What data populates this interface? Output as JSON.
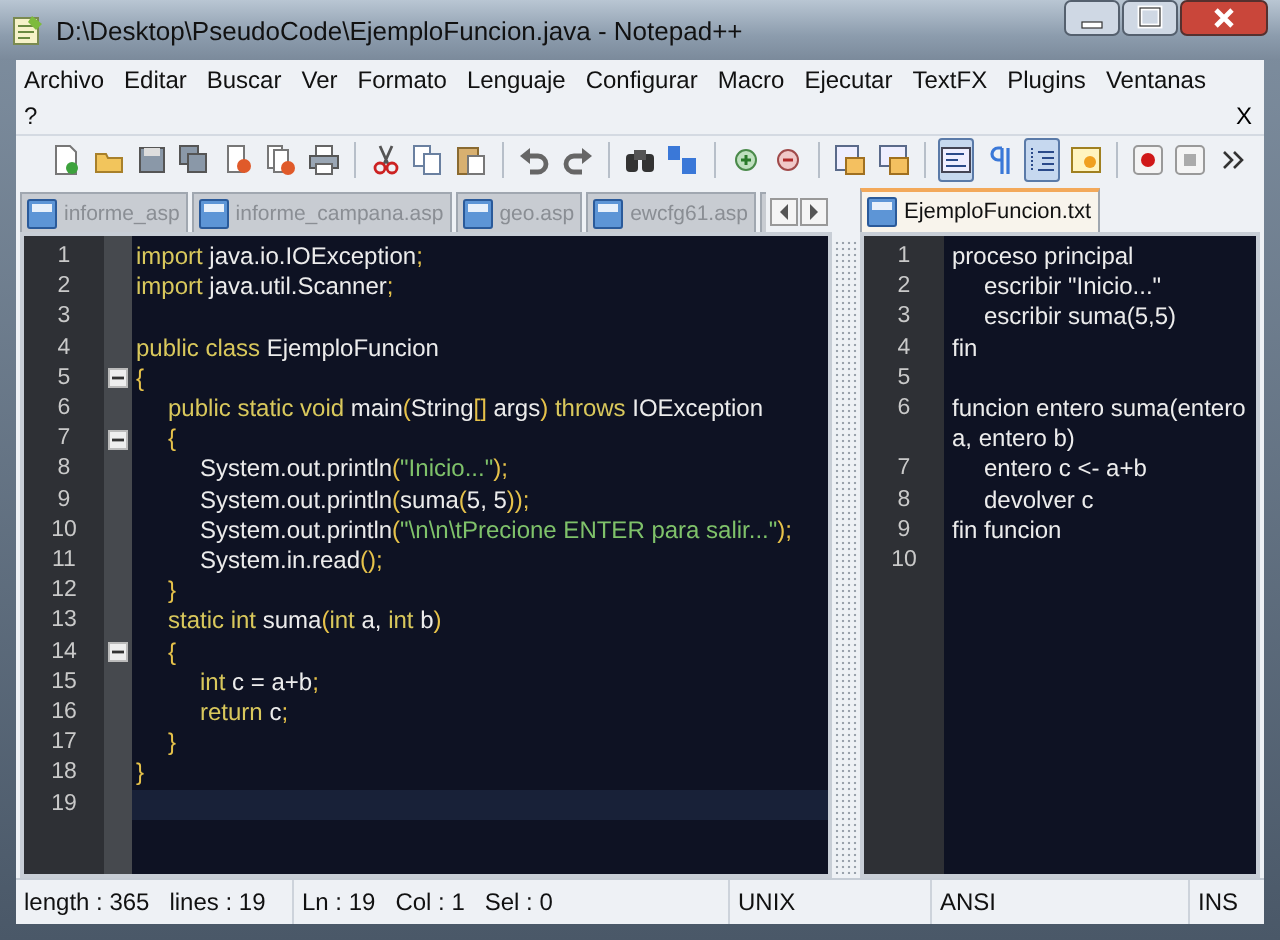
{
  "window": {
    "title": "D:\\Desktop\\PseudoCode\\EjemploFuncion.java - Notepad++"
  },
  "menu": {
    "items": [
      "Archivo",
      "Editar",
      "Buscar",
      "Ver",
      "Formato",
      "Lenguaje",
      "Configurar",
      "Macro",
      "Ejecutar",
      "TextFX",
      "Plugins",
      "Ventanas",
      "?"
    ],
    "close_document": "X"
  },
  "toolbar": [
    {
      "kind": "new",
      "pressed": false
    },
    {
      "kind": "open",
      "pressed": false
    },
    {
      "kind": "save",
      "pressed": false
    },
    {
      "kind": "save-all",
      "pressed": false
    },
    {
      "kind": "close",
      "pressed": false
    },
    {
      "kind": "close-all",
      "pressed": false
    },
    {
      "kind": "print",
      "pressed": false
    },
    {
      "kind": "separator"
    },
    {
      "kind": "cut",
      "pressed": false
    },
    {
      "kind": "copy",
      "pressed": false
    },
    {
      "kind": "paste",
      "pressed": false
    },
    {
      "kind": "separator"
    },
    {
      "kind": "undo",
      "pressed": false
    },
    {
      "kind": "redo",
      "pressed": false
    },
    {
      "kind": "separator"
    },
    {
      "kind": "find",
      "pressed": false
    },
    {
      "kind": "replace",
      "pressed": false
    },
    {
      "kind": "separator"
    },
    {
      "kind": "zoom-in",
      "pressed": false
    },
    {
      "kind": "zoom-out",
      "pressed": false
    },
    {
      "kind": "separator"
    },
    {
      "kind": "sync-vertical",
      "pressed": false
    },
    {
      "kind": "sync-horizontal",
      "pressed": false
    },
    {
      "kind": "separator"
    },
    {
      "kind": "word-wrap",
      "pressed": true
    },
    {
      "kind": "all-chars",
      "pressed": false
    },
    {
      "kind": "indent-guide",
      "pressed": true
    },
    {
      "kind": "user-language",
      "pressed": false
    },
    {
      "kind": "separator"
    },
    {
      "kind": "record",
      "pressed": false
    },
    {
      "kind": "stop",
      "pressed": false
    },
    {
      "kind": "more",
      "pressed": false
    }
  ],
  "left_view": {
    "tabs": [
      {
        "label": "informe_asp",
        "selected": false
      },
      {
        "label": "informe_campana.asp",
        "selected": false
      },
      {
        "label": "geo.asp",
        "selected": false
      },
      {
        "label": "ewcfg61.asp",
        "selected": false
      },
      {
        "selected": false
      }
    ],
    "lines": [
      {
        "number": "1",
        "fold": false,
        "current": false,
        "tokens": [
          {
            "kind": "keyword",
            "text": "import"
          },
          {
            "kind": "plain",
            "text": " java.io.IOException"
          },
          {
            "kind": "punct",
            "text": ";"
          }
        ]
      },
      {
        "number": "2",
        "fold": false,
        "current": false,
        "tokens": [
          {
            "kind": "keyword",
            "text": "import"
          },
          {
            "kind": "plain",
            "text": " java.util.Scanner"
          },
          {
            "kind": "punct",
            "text": ";"
          }
        ]
      },
      {
        "number": "3",
        "fold": false,
        "current": false
      },
      {
        "number": "4",
        "fold": false,
        "current": false,
        "tokens": [
          {
            "kind": "keyword",
            "text": "public class"
          },
          {
            "kind": "plain",
            "text": " EjemploFuncion"
          }
        ]
      },
      {
        "number": "5",
        "fold": true,
        "current": false,
        "tokens": [
          {
            "kind": "punct",
            "text": "{"
          }
        ]
      },
      {
        "number": "6",
        "fold": false,
        "current": false,
        "tokens": [
          {
            "kind": "keyword",
            "text": "\tpublic static void"
          },
          {
            "kind": "plain",
            "text": " main"
          },
          {
            "kind": "punct",
            "text": "("
          },
          {
            "kind": "plain",
            "text": "String"
          },
          {
            "kind": "punct",
            "text": "[]"
          },
          {
            "kind": "plain",
            "text": " args"
          },
          {
            "kind": "punct",
            "text": ")"
          },
          {
            "kind": "keyword",
            "text": " throws"
          },
          {
            "kind": "plain",
            "text": " IOException"
          }
        ]
      },
      {
        "number": "7",
        "fold": true,
        "current": false,
        "tokens": [
          {
            "kind": "punct",
            "text": "\t{"
          }
        ]
      },
      {
        "number": "8",
        "fold": false,
        "current": false,
        "tokens": [
          {
            "kind": "plain",
            "text": "\t\tSystem.out.println"
          },
          {
            "kind": "punct",
            "text": "("
          },
          {
            "kind": "string",
            "text": "\"Inicio...\""
          },
          {
            "kind": "punct",
            "text": ");"
          }
        ]
      },
      {
        "number": "9",
        "fold": false,
        "current": false,
        "tokens": [
          {
            "kind": "plain",
            "text": "\t\tSystem.out.println"
          },
          {
            "kind": "punct",
            "text": "("
          },
          {
            "kind": "plain",
            "text": "suma"
          },
          {
            "kind": "punct",
            "text": "("
          },
          {
            "kind": "plain",
            "text": "5, 5"
          },
          {
            "kind": "punct",
            "text": "));"
          }
        ]
      },
      {
        "number": "10",
        "fold": false,
        "current": false,
        "tokens": [
          {
            "kind": "plain",
            "text": "\t\tSystem.out.println"
          },
          {
            "kind": "punct",
            "text": "("
          },
          {
            "kind": "string",
            "text": "\"\\n\\n\\tPrecione ENTER para salir...\""
          },
          {
            "kind": "punct",
            "text": ");"
          }
        ]
      },
      {
        "number": "11",
        "fold": false,
        "current": false,
        "tokens": [
          {
            "kind": "plain",
            "text": "\t\tSystem.in.read"
          },
          {
            "kind": "punct",
            "text": "();"
          }
        ]
      },
      {
        "number": "12",
        "fold": false,
        "current": false,
        "tokens": [
          {
            "kind": "punct",
            "text": "\t}"
          }
        ]
      },
      {
        "number": "13",
        "fold": false,
        "current": false,
        "tokens": [
          {
            "kind": "keyword",
            "text": "\tstatic int"
          },
          {
            "kind": "plain",
            "text": " suma"
          },
          {
            "kind": "punct",
            "text": "("
          },
          {
            "kind": "keyword",
            "text": "int"
          },
          {
            "kind": "plain",
            "text": " a, "
          },
          {
            "kind": "keyword",
            "text": "int"
          },
          {
            "kind": "plain",
            "text": " b"
          },
          {
            "kind": "punct",
            "text": ")"
          }
        ]
      },
      {
        "number": "14",
        "fold": true,
        "current": false,
        "tokens": [
          {
            "kind": "punct",
            "text": "\t{"
          }
        ]
      },
      {
        "number": "15",
        "fold": false,
        "current": false,
        "tokens": [
          {
            "kind": "keyword",
            "text": "\t\tint"
          },
          {
            "kind": "plain",
            "text": " c = a+b"
          },
          {
            "kind": "punct",
            "text": ";"
          }
        ]
      },
      {
        "number": "16",
        "fold": false,
        "current": false,
        "tokens": [
          {
            "kind": "keyword",
            "text": "\t\treturn"
          },
          {
            "kind": "plain",
            "text": " c"
          },
          {
            "kind": "punct",
            "text": ";"
          }
        ]
      },
      {
        "number": "17",
        "fold": false,
        "current": false,
        "tokens": [
          {
            "kind": "punct",
            "text": "\t}"
          }
        ]
      },
      {
        "number": "18",
        "fold": false,
        "current": false,
        "tokens": [
          {
            "kind": "punct",
            "text": "}"
          }
        ]
      },
      {
        "number": "19",
        "fold": false,
        "current": true
      }
    ]
  },
  "right_view": {
    "tabs": [
      {
        "label": "EjemploFuncion.txt",
        "selected": true
      }
    ],
    "lines": [
      {
        "number": "1",
        "text": "proceso principal"
      },
      {
        "number": "2",
        "text": "\tescribir \"Inicio...\""
      },
      {
        "number": "3",
        "text": "\tescribir suma(5,5)"
      },
      {
        "number": "4",
        "text": "fin"
      },
      {
        "number": "5"
      },
      {
        "number": "6",
        "text": "funcion entero suma(entero a, entero b)"
      },
      {
        "number": "7",
        "text": "\tentero c <- a+b"
      },
      {
        "number": "8",
        "text": "\tdevolver c"
      },
      {
        "number": "9",
        "text": "fin funcion"
      },
      {
        "number": "10"
      }
    ]
  },
  "status_bar": [
    "length : 365   lines : 19",
    "Ln : 19   Col : 1   Sel : 0",
    "UNIX",
    "ANSI",
    "INS"
  ]
}
